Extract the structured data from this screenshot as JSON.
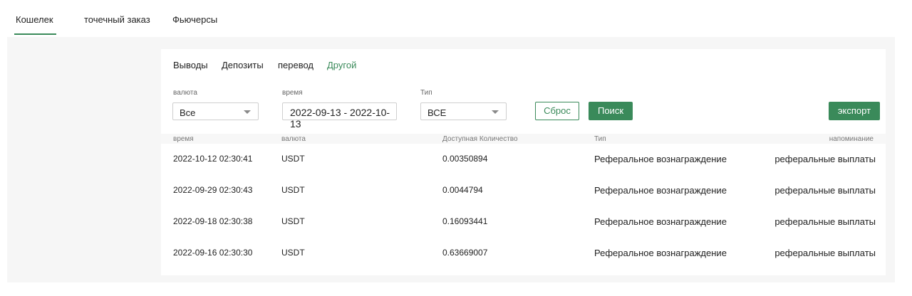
{
  "top_tabs": [
    "Кошелек",
    "точечный заказ",
    "Фьючерсы"
  ],
  "sub_tabs": [
    "Выводы",
    "Депозиты",
    "перевод",
    "Другой"
  ],
  "filters": {
    "currency": {
      "label": "валюта",
      "value": "Все"
    },
    "time": {
      "label": "время",
      "value": "2022-09-13 - 2022-10-13"
    },
    "type": {
      "label": "Тип",
      "value": "ВСЕ"
    }
  },
  "buttons": {
    "reset": "Сброс",
    "search": "Поиск",
    "export": "экспорт"
  },
  "colors": {
    "accent": "#3a8a5a",
    "panel_bg": "#f6f6f6"
  },
  "table": {
    "columns": [
      "время",
      "валюта",
      "Доступная Количество",
      "Тип",
      "напоминание"
    ],
    "rows": [
      [
        "2022-10-12 02:30:41",
        "USDT",
        "0.00350894",
        "Реферальное вознаграждение",
        "реферальные выплаты"
      ],
      [
        "2022-09-29 02:30:43",
        "USDT",
        "0.0044794",
        "Реферальное вознаграждение",
        "реферальные выплаты"
      ],
      [
        "2022-09-18 02:30:38",
        "USDT",
        "0.16093441",
        "Реферальное вознаграждение",
        "реферальные выплаты"
      ],
      [
        "2022-09-16 02:30:30",
        "USDT",
        "0.63669007",
        "Реферальное вознаграждение",
        "реферальные выплаты"
      ]
    ]
  }
}
